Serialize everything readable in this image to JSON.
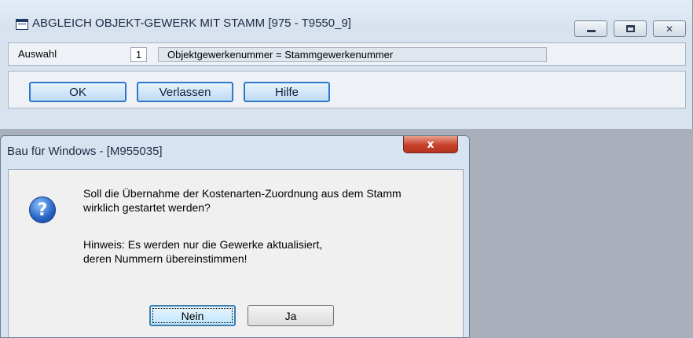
{
  "main_window": {
    "title": "ABGLEICH OBJEKT-GEWERK MIT STAMM  [975 - T9550_9]",
    "controls": {
      "minimize": "minimize-icon",
      "maximize": "maximize-icon",
      "close": "✕"
    },
    "auswahl": {
      "label": "Auswahl",
      "number": "1",
      "value": "Objektgewerkenummer = Stammgewerkenummer"
    },
    "buttons": {
      "ok": "OK",
      "verlassen": "Verlassen",
      "hilfe": "Hilfe"
    }
  },
  "dialog": {
    "title": "Bau für Windows - [M955035]",
    "close": "x",
    "icon": "question-icon",
    "message_lines": [
      "Soll die Übernahme der Kostenarten-Zuordnung aus dem Stamm",
      "wirklich gestartet werden?",
      "Hinweis: Es werden nur die Gewerke aktualisiert,",
      "deren Nummern übereinstimmen!"
    ],
    "buttons": {
      "no": "Nein",
      "yes": "Ja"
    }
  },
  "colors": {
    "desktop": "#aab0bb",
    "window_bg": "#d9e3ef",
    "button_blue_border": "#2d78c9",
    "close_red": "#c7402b"
  }
}
